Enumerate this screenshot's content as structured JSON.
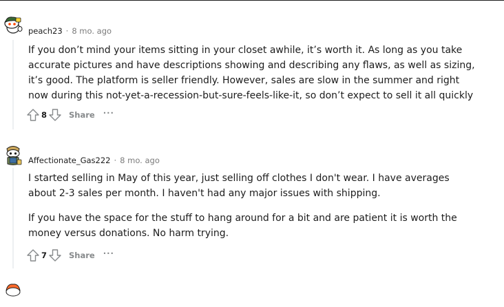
{
  "comments": [
    {
      "author": "peach23",
      "time": "8 mo. ago",
      "paragraphs": [
        "If you don’t mind your items sitting in your closet awhile, it’s worth it. As long as you take accurate pictures and have descriptions showing and describing any flaws, as well as sizing, it’s good. The platform is seller friendly. However, sales are slow in the summer and right now during this not-yet-a-recession-but-sure-feels-like-it, so don’t expect to sell it all quickly"
      ],
      "score": "8",
      "share_label": "Share",
      "more_label": "···"
    },
    {
      "author": "Affectionate_Gas222",
      "time": "8 mo. ago",
      "paragraphs": [
        "I started selling in May of this year, just selling off clothes I don't wear. I have averages about 2-3 sales per month. I haven't had any major issues with shipping.",
        "If you have the space for the stuff to hang around for a bit and are patient it is worth the money versus donations. No harm trying."
      ],
      "score": "7",
      "share_label": "Share",
      "more_label": "···"
    }
  ],
  "separator": "·",
  "colors": {
    "text": "#1c1c1c",
    "meta": "#7c7c7c",
    "action": "#878a8c",
    "thread": "#edeff1"
  },
  "icons": {
    "upvote": "upvote-arrow-icon",
    "downvote": "downvote-arrow-icon",
    "more": "more-dots-icon"
  }
}
